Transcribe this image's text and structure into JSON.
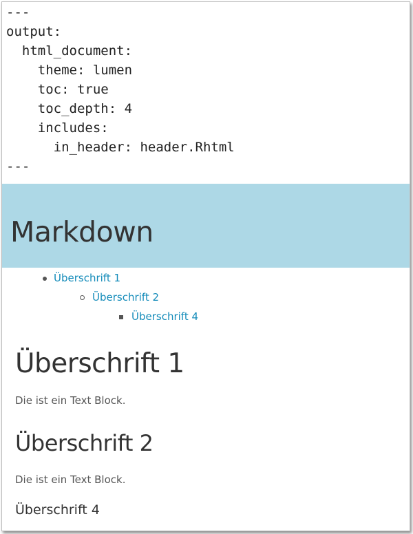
{
  "yaml_header": {
    "lines": [
      "---",
      "output:",
      "  html_document:",
      "    theme: lumen",
      "    toc: true",
      "    toc_depth: 4",
      "    includes:",
      "      in_header: header.Rhtml",
      "---"
    ]
  },
  "banner": {
    "title": "Markdown",
    "background_color": "#add8e6"
  },
  "toc": {
    "link_color": "#158cba",
    "items": [
      {
        "label": "Überschrift 1",
        "level": 1,
        "bullet": "disc"
      },
      {
        "label": "Überschrift 2",
        "level": 2,
        "bullet": "circle"
      },
      {
        "label": "Überschrift 4",
        "level": 3,
        "bullet": "square"
      }
    ]
  },
  "content": {
    "heading1": "Überschrift 1",
    "paragraph1": "Die ist ein Text Block.",
    "heading2": "Überschrift 2",
    "paragraph2": "Die ist ein Text Block.",
    "heading4": "Überschrift 4"
  }
}
